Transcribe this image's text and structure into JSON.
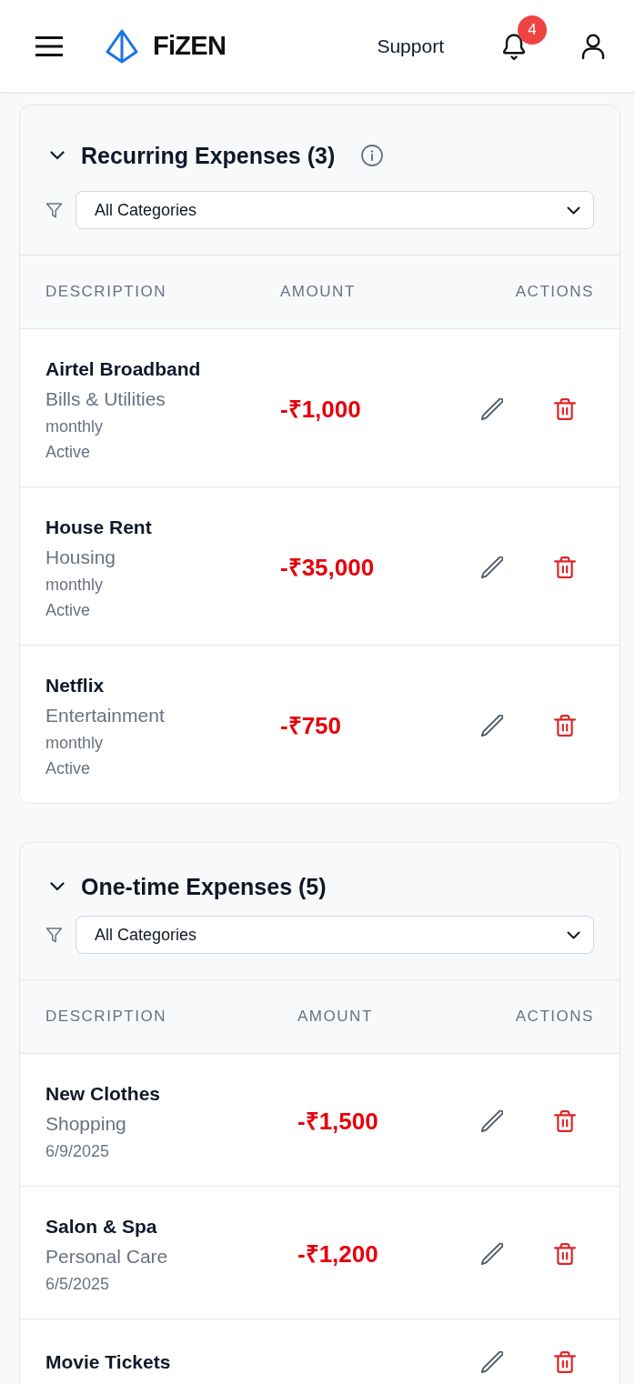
{
  "header": {
    "logo_text": "FiZEN",
    "support_link": "Support",
    "notification_count": "4"
  },
  "sections": [
    {
      "title": "Recurring Expenses (3)",
      "expanded": true,
      "info_icon": true,
      "filter": {
        "value": "All Categories"
      },
      "columns": [
        "DESCRIPTION",
        "AMOUNT",
        "ACTIONS"
      ],
      "rows": [
        {
          "name": "Airtel Broadband",
          "category": "Bills & Utilities",
          "frequency": "monthly",
          "status": "Active",
          "amount": "-₹1,000"
        },
        {
          "name": "House Rent",
          "category": "Housing",
          "frequency": "monthly",
          "status": "Active",
          "amount": "-₹35,000"
        },
        {
          "name": "Netflix",
          "category": "Entertainment",
          "frequency": "monthly",
          "status": "Active",
          "amount": "-₹750"
        }
      ]
    },
    {
      "title": "One-time Expenses (5)",
      "expanded": true,
      "info_icon": false,
      "filter": {
        "value": "All Categories"
      },
      "columns": [
        "DESCRIPTION",
        "AMOUNT",
        "ACTIONS"
      ],
      "rows": [
        {
          "name": "New Clothes",
          "category": "Shopping",
          "date": "6/9/2025",
          "amount": "-₹1,500"
        },
        {
          "name": "Salon & Spa",
          "category": "Personal Care",
          "date": "6/5/2025",
          "amount": "-₹1,200"
        },
        {
          "name": "Movie Tickets"
        }
      ]
    }
  ]
}
